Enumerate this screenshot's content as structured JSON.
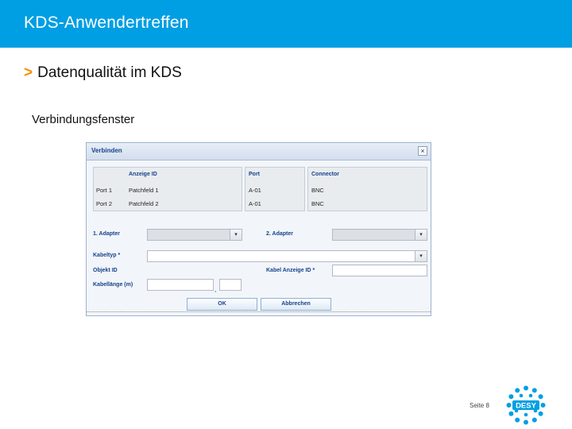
{
  "slide": {
    "header_title": "KDS-Anwendertreffen",
    "subtitle_marker": ">",
    "subtitle": "Datenqualität im KDS",
    "caption": "Verbindungsfenster",
    "page_label": "Seite 8",
    "logo_text": "DESY",
    "colors": {
      "header": "#009fe3",
      "accent": "#f39200"
    }
  },
  "dialog": {
    "title": "Verbinden",
    "close_glyph": "×",
    "table": {
      "headers": [
        "Anzeige ID",
        "Port",
        "Connector"
      ],
      "rows": [
        {
          "label": "Port 1",
          "anzeige_id": "Patchfeld 1",
          "port": "A-01",
          "connector": "BNC"
        },
        {
          "label": "Port 2",
          "anzeige_id": "Patchfeld 2",
          "port": "A-01",
          "connector": "BNC"
        }
      ]
    },
    "adapter1_label": "1. Adapter",
    "adapter2_label": "2. Adapter",
    "kabeltyp_label": "Kabeltyp *",
    "objekt_id_label": "Objekt ID",
    "kabel_anzeige_label": "Kabel Anzeige ID *",
    "kabellaenge_label": "Kabellänge (m)",
    "decimal_sep": ",",
    "dropdown_icon": "chevron-down-icon",
    "ok_label": "OK",
    "cancel_label": "Abbrechen"
  }
}
